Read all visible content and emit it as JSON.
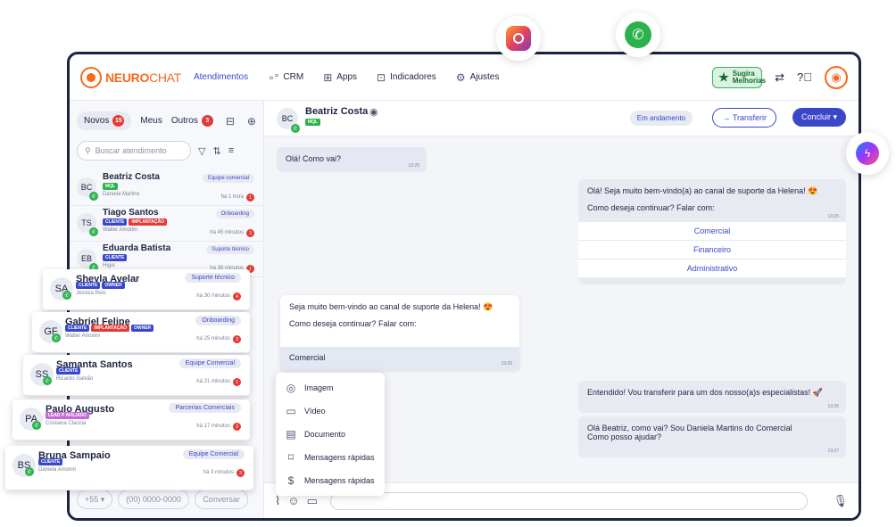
{
  "brand": {
    "name_a": "NEURO",
    "name_b": "CHAT"
  },
  "nav": [
    {
      "label": "Atendimentos",
      "active": true
    },
    {
      "label": "CRM"
    },
    {
      "label": "Apps"
    },
    {
      "label": "Indicadores"
    },
    {
      "label": "Ajustes"
    }
  ],
  "topbar": {
    "suggest_line1": "Sugira",
    "suggest_line2": "Melhorias"
  },
  "left": {
    "tabs": [
      {
        "label": "Novos",
        "count": "15"
      },
      {
        "label": "Meus"
      },
      {
        "label": "Outros",
        "count": "3"
      }
    ],
    "search_placeholder": "Buscar atendimento",
    "conversations": [
      {
        "initials": "BC",
        "name": "Beatriz Costa",
        "tags": [
          "MQL"
        ],
        "agent": "Daniela Martins",
        "dept": "Equipe comercial",
        "time": "há 1 hora",
        "count": "1"
      },
      {
        "initials": "TS",
        "name": "Tiago Santos",
        "tags": [
          "CLIENTE",
          "IMPLANTAÇÃO"
        ],
        "agent": "Walter Amorim",
        "dept": "Onboarding",
        "time": "há 45 minutos",
        "count": "3"
      },
      {
        "initials": "EB",
        "name": "Eduarda Batista",
        "tags": [
          "CLIENTE"
        ],
        "agent": "Higor",
        "dept": "Suporte técnico",
        "time": "há 38 minutos",
        "count": "1"
      }
    ],
    "ddd": "+55",
    "phone_placeholder": "(00) 0000-0000",
    "start_label": "Conversar"
  },
  "cards": [
    {
      "initials": "SA",
      "name": "Sheyla Avelar",
      "tags": [
        "CLIENTE",
        "OWNER"
      ],
      "agent": "Jéssica Reis",
      "dept": "Suporte técnico",
      "time": "há 30 minutos",
      "count": "4"
    },
    {
      "initials": "GF",
      "name": "Gabriel Felipe",
      "tags": [
        "CLIENTE",
        "IMPLANTAÇÃO",
        "OWNER"
      ],
      "agent": "Walter Amorim",
      "dept": "Onboarding",
      "time": "há 25 minutos",
      "count": "3"
    },
    {
      "initials": "SS",
      "name": "Samanta Santos",
      "tags": [
        "CLIENTE"
      ],
      "agent": "Ricardo Galvão",
      "dept": "Equipe Comercial",
      "time": "há 21 minutos",
      "count": "1"
    },
    {
      "initials": "PA",
      "name": "Paulo Augusto",
      "tags": [
        "LEAD P AFILIADO"
      ],
      "agent": "Cristiana Clarizia",
      "dept": "Parcerias Comerciais",
      "time": "há 17 minutos",
      "count": "3"
    },
    {
      "initials": "BS",
      "name": "Bruna Sampaio",
      "tags": [
        "CLIENTE"
      ],
      "agent": "Daniela Amorim",
      "dept": "Equipe Comercial",
      "time": "há 3 minutos",
      "count": "3"
    }
  ],
  "chat": {
    "initials": "BC",
    "name": "Beatriz Costa",
    "tag": "MQL",
    "status": "Em andamento",
    "transfer": "Transferir",
    "conclude": "Concluir",
    "m1": {
      "text": "Olá! Como vai?",
      "time": "13:25"
    },
    "m2": {
      "text1": "Olá! Seja muito bem-vindo(a) ao canal de suporte da Helena! 😍",
      "text2": "Como deseja continuar? Falar com:",
      "time": "13:25",
      "options": [
        "Comercial",
        "Financeiro",
        "Administrativo"
      ]
    },
    "m3": {
      "text1": "Seja muito bem-vindo ao canal de suporte da Helena! 😍",
      "text2": "Como deseja continuar? Falar com:",
      "reply": "Comercial",
      "time": "13:26"
    },
    "m4": {
      "text": "Entendido! Vou transferir para um dos nosso(a)s especialistas! 🚀",
      "time": "13:26"
    },
    "m5": {
      "text1": "Olá Beatriz, como vai? Sou Daniela Martins do Comercial",
      "text2": "Como posso ajudar?",
      "time": "13:27"
    }
  },
  "attach": [
    "Imagem",
    "Vídeo",
    "Documento",
    "Mensagens rápidas",
    "Mensagens rápidas"
  ],
  "tag_colors": {
    "MQL": "#2bb24c",
    "CLIENTE": "#3a47c9",
    "IMPLANTAÇÃO": "#e53935",
    "OWNER": "#3a47c9",
    "LEAD P AFILIADO": "#c56bd6"
  }
}
